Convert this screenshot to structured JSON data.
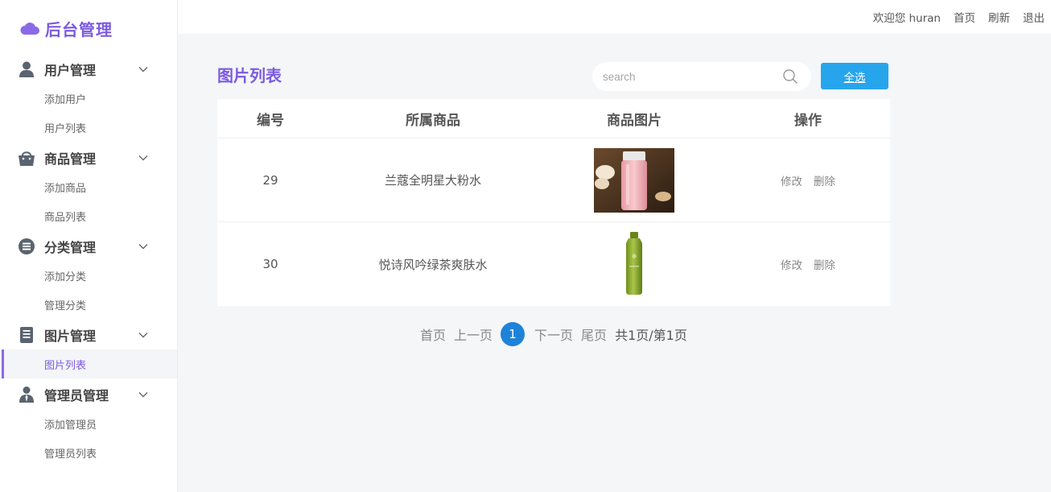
{
  "brand": {
    "title": "后台管理"
  },
  "topbar": {
    "welcome": "欢迎您 huran",
    "home": "首页",
    "refresh": "刷新",
    "logout": "退出"
  },
  "sidebar": {
    "groups": [
      {
        "label": "用户管理",
        "icon": "user-icon",
        "items": [
          "添加用户",
          "用户列表"
        ]
      },
      {
        "label": "商品管理",
        "icon": "basket-icon",
        "items": [
          "添加商品",
          "商品列表"
        ]
      },
      {
        "label": "分类管理",
        "icon": "list-circle-icon",
        "items": [
          "添加分类",
          "管理分类"
        ]
      },
      {
        "label": "图片管理",
        "icon": "document-icon",
        "items": [
          "图片列表"
        ]
      },
      {
        "label": "管理员管理",
        "icon": "admin-icon",
        "items": [
          "添加管理员",
          "管理员列表"
        ]
      }
    ],
    "active_item": "图片列表"
  },
  "main": {
    "title": "图片列表",
    "search": {
      "placeholder": "search",
      "value": ""
    },
    "select_all": "全选",
    "table": {
      "headers": [
        "编号",
        "所属商品",
        "商品图片",
        "操作"
      ],
      "rows": [
        {
          "id": "29",
          "product": "兰蔻全明星大粉水",
          "image": "pink-toner-bottle",
          "edit": "修改",
          "delete": "删除"
        },
        {
          "id": "30",
          "product": "悦诗风吟绿茶爽肤水",
          "image": "green-tea-toner-bottle",
          "edit": "修改",
          "delete": "删除"
        }
      ]
    },
    "pagination": {
      "first": "首页",
      "prev": "上一页",
      "current": "1",
      "next": "下一页",
      "last": "尾页",
      "total": "共1页/第1页"
    }
  },
  "colors": {
    "accent": "#7b5ae0",
    "button": "#27a5ec",
    "page_active": "#1e83d8"
  }
}
